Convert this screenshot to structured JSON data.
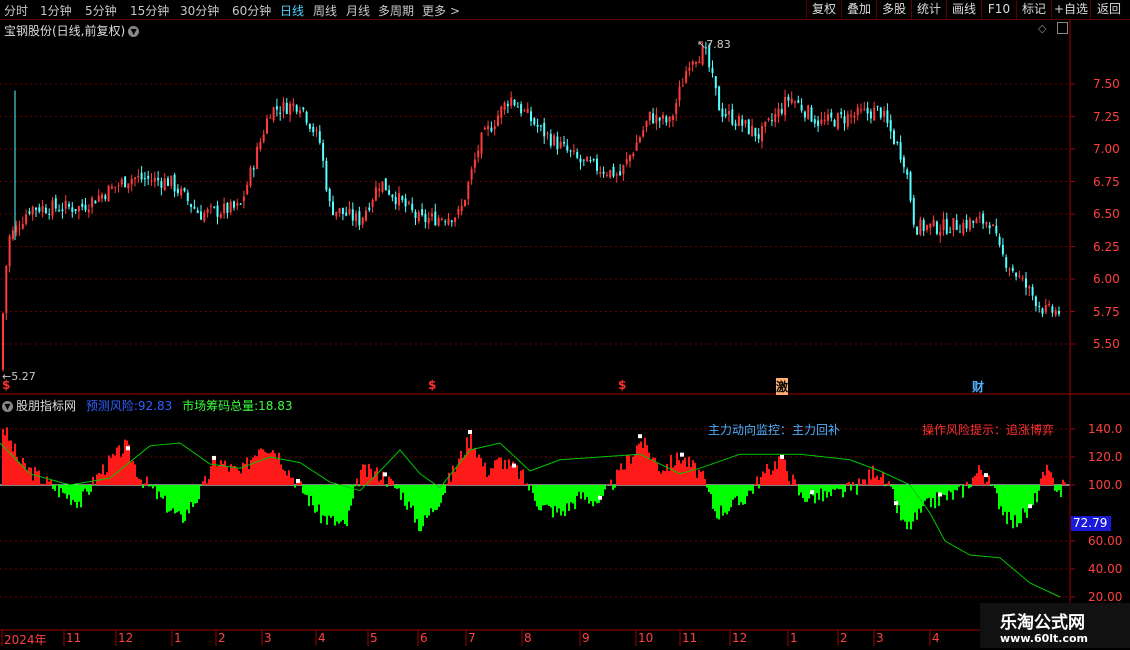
{
  "toolbar": {
    "periods": [
      {
        "label": "分时",
        "active": false
      },
      {
        "label": "1分钟",
        "active": false
      },
      {
        "label": "5分钟",
        "active": false
      },
      {
        "label": "15分钟",
        "active": false
      },
      {
        "label": "30分钟",
        "active": false
      },
      {
        "label": "60分钟",
        "active": false
      },
      {
        "label": "日线",
        "active": true
      },
      {
        "label": "周线",
        "active": false
      },
      {
        "label": "月线",
        "active": false
      },
      {
        "label": "多周期",
        "active": false
      },
      {
        "label": "更多 >",
        "active": false
      }
    ],
    "buttons": [
      "复权",
      "叠加",
      "多股",
      "统计",
      "画线",
      "F10",
      "标记",
      "+自选",
      "返回"
    ]
  },
  "main_chart": {
    "title": "宝钢股份(日线,前复权)",
    "price_axis": [
      "7.50",
      "7.25",
      "7.00",
      "6.75",
      "6.50",
      "6.25",
      "6.00",
      "5.75",
      "5.50"
    ],
    "high_label": "7.83",
    "low_label": "5.27",
    "event_markers": [
      {
        "text": "$",
        "color": "#ff3030"
      },
      {
        "text": "$",
        "color": "#ff3030"
      },
      {
        "text": "$",
        "color": "#ff3030"
      },
      {
        "text": "激",
        "color": "#ffb070"
      },
      {
        "text": "财",
        "color": "#4fb0ff"
      }
    ]
  },
  "indicator": {
    "name": "股朋指标网",
    "risk_label": "预测风险:",
    "risk_value": "92.83",
    "chips_label": "市场筹码总量:",
    "chips_value": "18.83",
    "monitor_text": "主力动向监控：主力回补",
    "risk_hint": "操作风险提示：追涨博弈",
    "axis": [
      "140.0",
      "120.0",
      "100.0",
      "72.79",
      "60.00",
      "40.00",
      "20.00"
    ],
    "current_value": "72.79"
  },
  "date_axis": [
    "2024年",
    "11",
    "12",
    "1",
    "2",
    "3",
    "4",
    "5",
    "6",
    "7",
    "8",
    "9",
    "10",
    "11",
    "12",
    "1",
    "2",
    "3",
    "4"
  ],
  "watermark": {
    "line1": "乐淘公式网",
    "line2": "www.60lt.com"
  },
  "colors": {
    "up": "#ff3c3c",
    "down": "#54ffff",
    "red_area": "#ff1a1a",
    "green_area": "#00ff00",
    "ma": "#00c800",
    "accent": "#4fd0ff"
  }
}
